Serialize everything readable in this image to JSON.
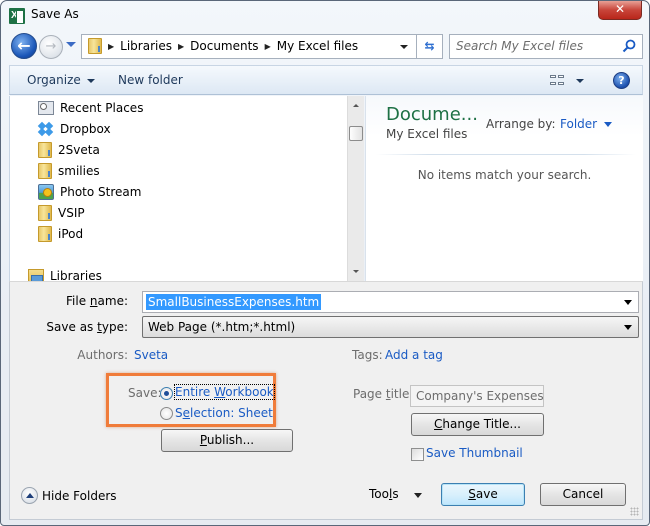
{
  "window": {
    "title": "Save As",
    "app_icon": "excel-icon",
    "close_label": "✕"
  },
  "navigation": {
    "back_icon": "back-arrow-icon",
    "forward_icon": "forward-arrow-icon",
    "breadcrumb": [
      "Libraries",
      "Documents",
      "My Excel files"
    ],
    "search_placeholder": "Search My Excel files"
  },
  "toolbar": {
    "organize_label": "Organize",
    "new_folder_label": "New folder",
    "view_icon": "change-view-icon",
    "help_icon": "help-icon",
    "help_glyph": "?"
  },
  "nav_pane": {
    "items": [
      {
        "label": "Recent Places",
        "icon": "recent-places-icon"
      },
      {
        "label": "Dropbox",
        "icon": "dropbox-icon"
      },
      {
        "label": "2Sveta",
        "icon": "folder-icon"
      },
      {
        "label": "smilies",
        "icon": "folder-icon"
      },
      {
        "label": "Photo Stream",
        "icon": "photo-stream-icon"
      },
      {
        "label": "VSIP",
        "icon": "folder-icon"
      },
      {
        "label": "iPod",
        "icon": "folder-icon"
      },
      {
        "label": "Libraries",
        "icon": "libraries-icon"
      }
    ]
  },
  "content_pane": {
    "library_title": "Docume...",
    "library_subtitle": "My Excel files",
    "arrange_by_label": "Arrange by:",
    "arrange_by_value": "Folder",
    "empty_message": "No items match your search."
  },
  "form": {
    "file_name_label_pre": "File ",
    "file_name_label_ul": "n",
    "file_name_label_post": "ame:",
    "file_name_value": "SmallBusinessExpenses.htm",
    "save_as_type_label_pre": "Save as ",
    "save_as_type_label_ul": "t",
    "save_as_type_label_post": "ype:",
    "save_as_type_value": "Web Page (*.htm;*.html)",
    "authors_label": "Authors:",
    "authors_value": "Sveta",
    "tags_label": "Tags:",
    "tags_value": "Add a tag",
    "save_scope_label": "Save:",
    "save_scope_options": [
      {
        "pre": "Entire ",
        "ul": "W",
        "post": "orkbook",
        "checked": true
      },
      {
        "pre": "S",
        "ul": "e",
        "post": "lection: Sheet",
        "checked": false
      }
    ],
    "publish_ul": "P",
    "publish_rest": "ublish...",
    "page_title_label_pre": "Page ",
    "page_title_label_ul": "t",
    "page_title_label_post": "itle:",
    "page_title_value": "Company's Expenses",
    "change_title_ul": "C",
    "change_title_rest": "hange Title...",
    "save_thumbnail_label": "Save Thumbnail",
    "save_thumbnail_checked": false
  },
  "footer": {
    "hide_folders_label": "Hide Folders",
    "tools_pre": "Too",
    "tools_ul": "l",
    "tools_post": "s",
    "save_ul": "S",
    "save_rest": "ave",
    "cancel_label": "Cancel"
  },
  "colors": {
    "accent_highlight": "#f07c3a",
    "link_blue": "#1a5bc4",
    "library_green": "#1e7145",
    "selection_blue": "#3399ff"
  }
}
